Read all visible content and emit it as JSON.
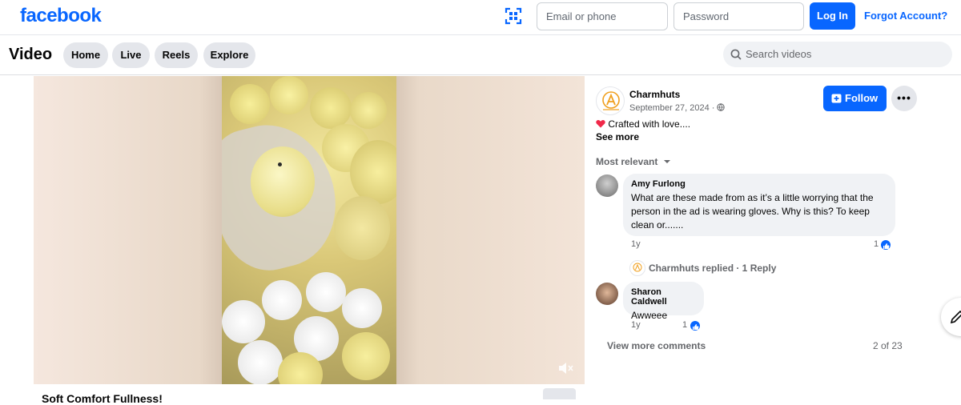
{
  "header": {
    "logo": "facebook",
    "email_placeholder": "Email or phone",
    "password_placeholder": "Password",
    "login_label": "Log In",
    "forgot_label": "Forgot Account?"
  },
  "nav": {
    "title": "Video",
    "tabs": [
      "Home",
      "Live",
      "Reels",
      "Explore"
    ],
    "search_placeholder": "Search videos"
  },
  "post": {
    "page_name": "Charmhuts",
    "date": "September 27, 2024 ·",
    "follow_label": "Follow",
    "more_label": "•••",
    "caption": "Crafted with love....",
    "see_more": "See more",
    "sort_label": "Most relevant",
    "video_title_partial": "Soft Comfort Fullness!"
  },
  "comments": [
    {
      "author": "Amy Furlong",
      "text": "What are these made from as it’s a little worrying that the person in the ad is wearing gloves. Why is this? To keep clean or.......",
      "age": "1y",
      "likes": "1"
    },
    {
      "author": "Sharon Caldwell",
      "text": "Awweee",
      "age": "1y",
      "likes": "1"
    }
  ],
  "reply_summary": "Charmhuts replied · 1 Reply",
  "view_more": "View more comments",
  "pager": "2 of 23",
  "colors": {
    "brand": "#0866ff",
    "muted": "#65676b",
    "bubble": "#f0f2f5"
  }
}
